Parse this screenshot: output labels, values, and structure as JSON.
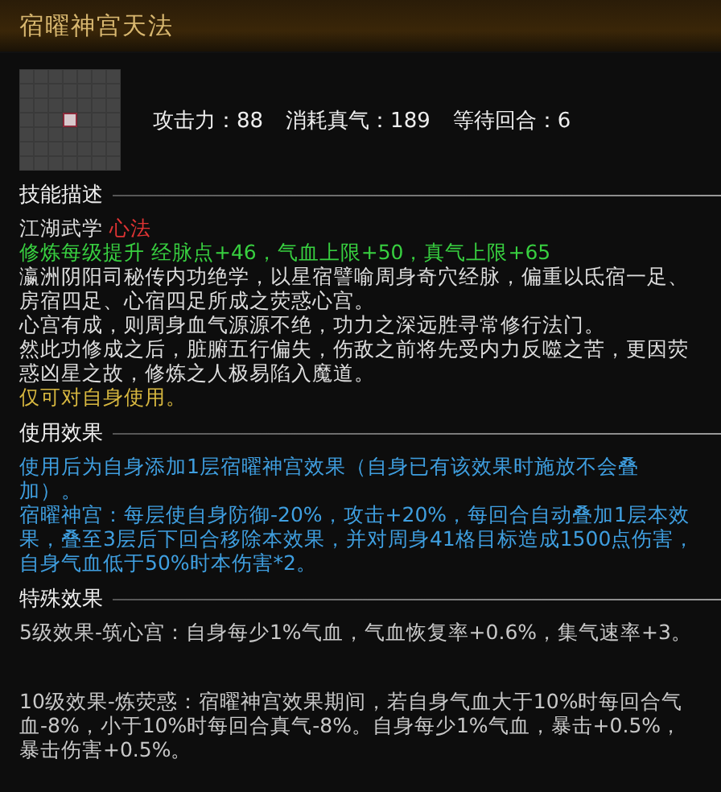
{
  "title": "宿曜神宫天法",
  "stats": [
    {
      "label": "攻击力：",
      "value": "88"
    },
    {
      "label": "消耗真气：",
      "value": "189"
    },
    {
      "label": "等待回合：",
      "value": "6"
    }
  ],
  "description": {
    "heading": "技能描述",
    "category": "江湖武学",
    "type": "心法",
    "growth": "修炼每级提升 经脉点+46，气血上限+50，真气上限+65",
    "lore": [
      "瀛洲阴阳司秘传内功绝学，以星宿譬喻周身奇穴经脉，偏重以氐宿一足、房宿四足、心宿四足所成之荧惑心宫。",
      "心宫有成，则周身血气源源不绝，功力之深远胜寻常修行法门。",
      "然此功修成之后，脏腑五行偏失，伤敌之前将先受内力反噬之苦，更因荧惑凶星之故，修炼之人极易陷入魔道。"
    ],
    "note": "仅可对自身使用。"
  },
  "usage": {
    "heading": "使用效果",
    "paragraphs": [
      "使用后为自身添加1层宿曜神宫效果（自身已有该效果时施放不会叠加）。",
      "宿曜神宫：每层使自身防御-20%，攻击+20%，每回合自动叠加1层本效果，叠至3层后下回合移除本效果，并对周身41格目标造成1500点伤害，自身气血低于50%时本伤害*2。"
    ]
  },
  "special": {
    "heading": "特殊效果",
    "effects": [
      "5级效果-筑心宫：自身每少1%气血，气血恢复率+0.6%，集气速率+3。",
      "10级效果-炼荧惑：宿曜神宫效果期间，若自身气血大于10%时每回合气血-8%，小于10%时每回合真气-8%。自身每少1%气血，暴击+0.5%，暴击伤害+0.5%。"
    ]
  }
}
